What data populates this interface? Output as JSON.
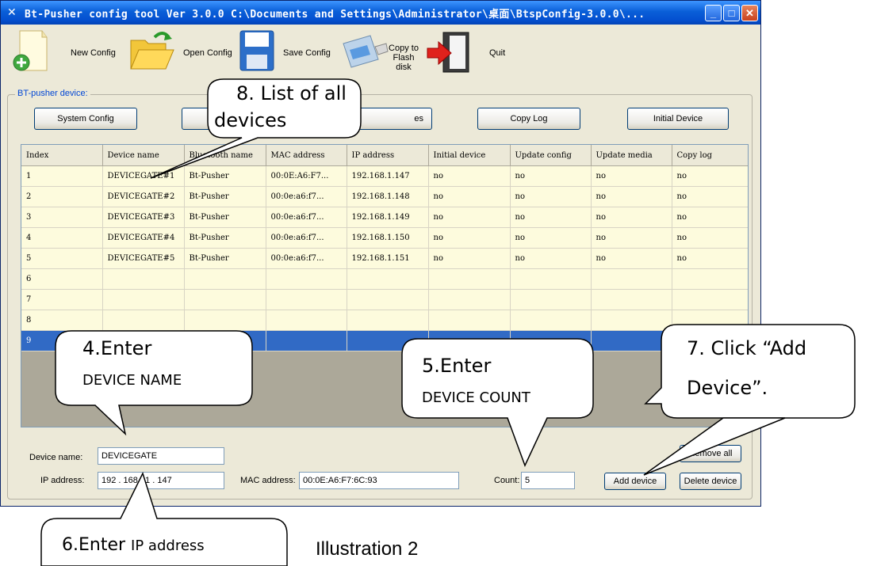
{
  "window": {
    "title": "Bt-Pusher config tool Ver 3.0.0    C:\\Documents and Settings\\Administrator\\桌面\\BtspConfig-3.0.0\\...",
    "minimize_label": "_",
    "maximize_label": "□",
    "close_label": "✕"
  },
  "toolbar": {
    "new_config": "New Config",
    "open_config": "Open Config",
    "save_config": "Save Config",
    "copy_flash": "Copy to Flash disk",
    "quit": "Quit"
  },
  "group": {
    "title": "BT-pusher device:",
    "buttons": {
      "system_config": "System Config",
      "update_devices": "es",
      "copy_log": "Copy Log",
      "initial_device": "Initial Device"
    }
  },
  "table": {
    "columns": [
      "Index",
      "Device name",
      "Bluetooth name",
      "MAC address",
      "IP address",
      "Initial device",
      "Update config",
      "Update media",
      "Copy log"
    ],
    "rows": [
      [
        "1",
        "DEVICEGATE#1",
        "Bt-Pusher",
        "00:0E:A6:F7...",
        "192.168.1.147",
        "no",
        "no",
        "no",
        "no"
      ],
      [
        "2",
        "DEVICEGATE#2",
        "Bt-Pusher",
        "00:0e:a6:f7...",
        "192.168.1.148",
        "no",
        "no",
        "no",
        "no"
      ],
      [
        "3",
        "DEVICEGATE#3",
        "Bt-Pusher",
        "00:0e:a6:f7...",
        "192.168.1.149",
        "no",
        "no",
        "no",
        "no"
      ],
      [
        "4",
        "DEVICEGATE#4",
        "Bt-Pusher",
        "00:0e:a6:f7...",
        "192.168.1.150",
        "no",
        "no",
        "no",
        "no"
      ],
      [
        "5",
        "DEVICEGATE#5",
        "Bt-Pusher",
        "00:0e:a6:f7...",
        "192.168.1.151",
        "no",
        "no",
        "no",
        "no"
      ],
      [
        "6",
        "",
        "",
        "",
        "",
        "",
        "",
        "",
        ""
      ],
      [
        "7",
        "",
        "",
        "",
        "",
        "",
        "",
        "",
        ""
      ],
      [
        "8",
        "",
        "",
        "",
        "",
        "",
        "",
        "",
        ""
      ],
      [
        "9",
        "",
        "",
        "",
        "",
        "",
        "",
        "",
        ""
      ]
    ],
    "selected_row": 9
  },
  "form": {
    "device_name_label": "Device name:",
    "device_name_value": "DEVICEGATE",
    "ip_label": "IP address:",
    "ip_value": "192  . 168  .  1   . 147",
    "mac_label": "MAC address:",
    "mac_value": "00:0E:A6:F7:6C:93",
    "count_label": "Count:",
    "count_value": "5",
    "remove_all": "Remove all",
    "add_device": "Add device",
    "delete_device": "Delete device"
  },
  "callouts": {
    "c8_line1": "8. List of all",
    "c8_line2": "devices",
    "c4_line1": "4.Enter",
    "c4_line2": "DEVICE NAME",
    "c5_line1": "5.Enter",
    "c5_line2": "DEVICE COUNT",
    "c7_line1": "7. Click “Add",
    "c7_line2": "Device”.",
    "c6_num": "6.Enter",
    "c6_rest": "IP address"
  },
  "caption": "Illustration 2",
  "colors": {
    "titlebar": "#0a5fd8",
    "selected_row": "#316ac5",
    "row_bg": "#fdfbdd",
    "window_bg": "#ece9d8"
  }
}
